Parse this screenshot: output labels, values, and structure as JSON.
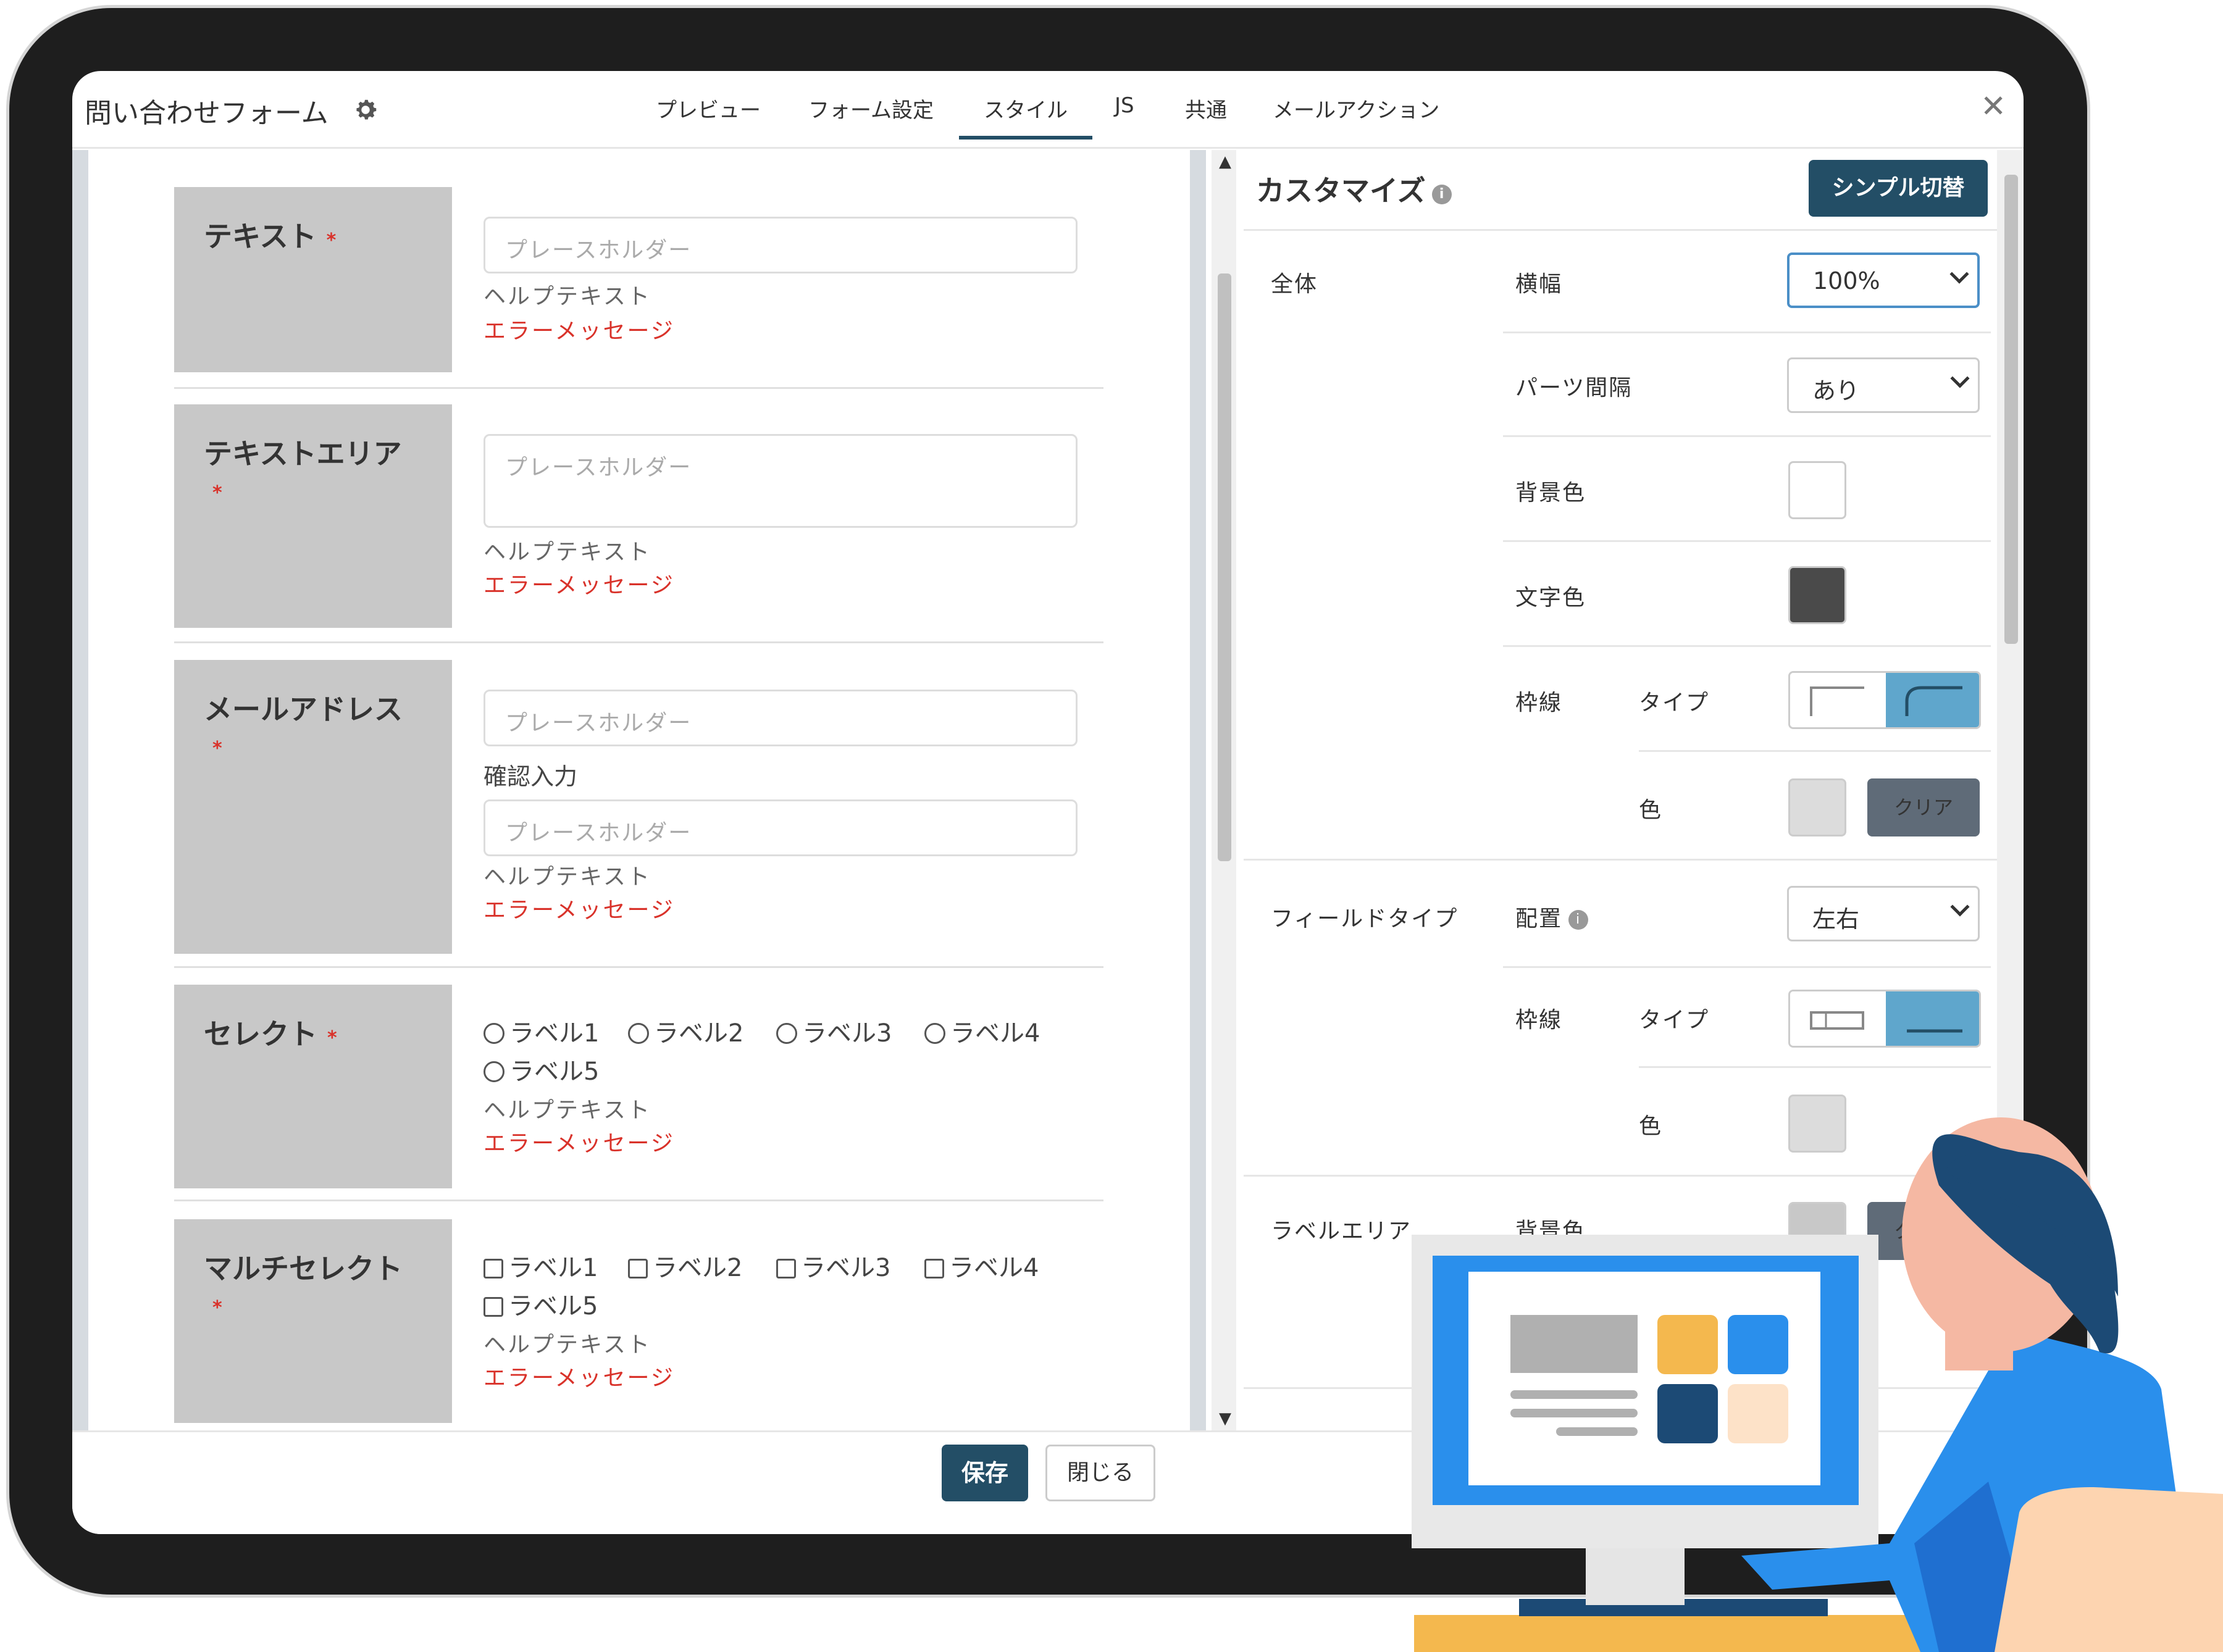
{
  "header": {
    "title": "問い合わせフォーム",
    "tabs": [
      {
        "label": "プレビュー"
      },
      {
        "label": "フォーム設定"
      },
      {
        "label": "スタイル"
      },
      {
        "label": "JS"
      },
      {
        "label": "共通"
      },
      {
        "label": "メールアクション"
      }
    ],
    "active_tab": "スタイル",
    "close_icon": "close-icon"
  },
  "fields": [
    {
      "label": "テキスト",
      "required": "*",
      "placeholder": "プレースホルダー",
      "help": "ヘルプテキスト",
      "error": "エラーメッセージ"
    },
    {
      "label": "テキストエリア",
      "required": "*",
      "placeholder": "プレースホルダー",
      "help": "ヘルプテキスト",
      "error": "エラーメッセージ"
    },
    {
      "label": "メールアドレス",
      "required": "*",
      "placeholder": "プレースホルダー",
      "confirm_label": "確認入力",
      "confirm_placeholder": "プレースホルダー",
      "help": "ヘルプテキスト",
      "error": "エラーメッセージ"
    },
    {
      "label": "セレクト",
      "required": "*",
      "options": [
        "ラベル1",
        "ラベル2",
        "ラベル3",
        "ラベル4",
        "ラベル5"
      ],
      "help": "ヘルプテキスト",
      "error": "エラーメッセージ"
    },
    {
      "label": "マルチセレクト",
      "required": "*",
      "options": [
        "ラベル1",
        "ラベル2",
        "ラベル3",
        "ラベル4",
        "ラベル5"
      ],
      "help": "ヘルプテキスト",
      "error": "エラーメッセージ"
    }
  ],
  "customize": {
    "heading": "カスタマイズ",
    "simple_toggle": "シンプル切替",
    "overall": {
      "section": "全体",
      "width_label": "横幅",
      "width_value": "100%",
      "spacing_label": "パーツ間隔",
      "spacing_value": "あり",
      "bg_label": "背景色",
      "bg_color": "#ffffff",
      "text_label": "文字色",
      "text_color": "#4a4a4a",
      "border_label": "枠線",
      "type_label": "タイプ",
      "color_label": "色",
      "border_color": "#dcdcdc",
      "clear_label": "クリア"
    },
    "field_type": {
      "section": "フィールドタイプ",
      "layout_label": "配置",
      "layout_value": "左右",
      "border_label": "枠線",
      "type_label": "タイプ",
      "color_label": "色",
      "border_color": "#dcdcdc"
    },
    "label_area": {
      "section": "ラベルエリア",
      "bg_label": "背景色",
      "clear_label": "クリア"
    }
  },
  "footer": {
    "save_label": "保存",
    "close_label": "閉じる"
  },
  "colors": {
    "primary": "#234e66",
    "required": "#d9322a",
    "active_toggle": "#5fa6cc",
    "label_bg": "#c8c8c8"
  }
}
